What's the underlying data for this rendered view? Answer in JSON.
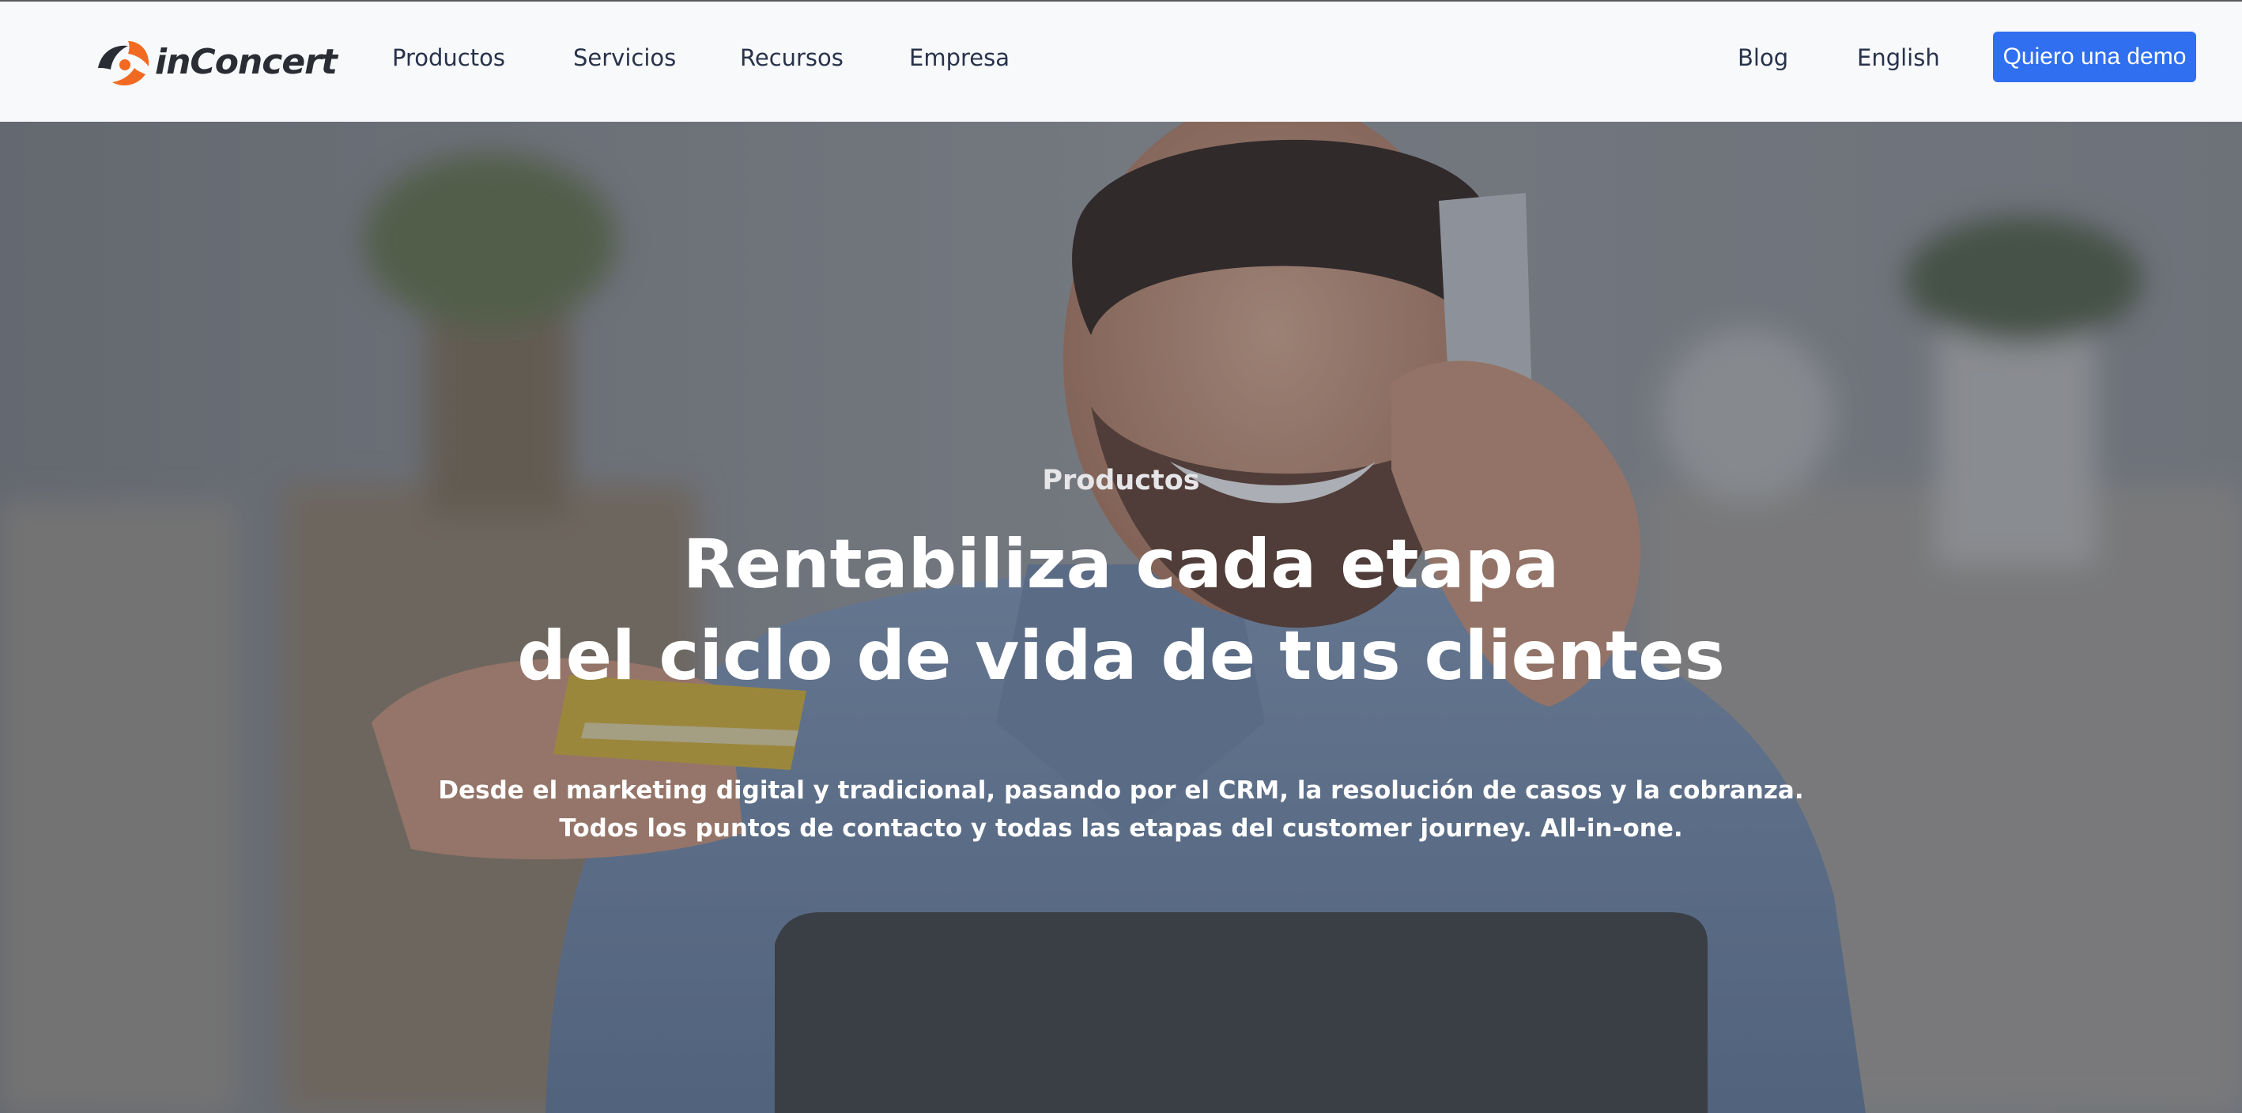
{
  "brand": {
    "name": "inConcert",
    "logo_icon": "inconcert-swirl-icon",
    "colors": {
      "accent": "#f26a21",
      "dark": "#2a2d33",
      "cta": "#2f6ff0"
    }
  },
  "nav": {
    "left": [
      "Productos",
      "Servicios",
      "Recursos",
      "Empresa"
    ],
    "right": [
      "Blog",
      "English"
    ],
    "cta_label": "Quiero una demo"
  },
  "hero": {
    "eyebrow": "Productos",
    "headline_line1": "Rentabiliza cada etapa",
    "headline_line2": "del ciclo de vida de tus clientes",
    "subtitle_line1": "Desde el marketing digital y tradicional, pasando por el CRM, la resolución de casos y la cobranza.",
    "subtitle_line2": "Todos los puntos de contacto y todas las etapas del customer journey. All-in-one."
  }
}
